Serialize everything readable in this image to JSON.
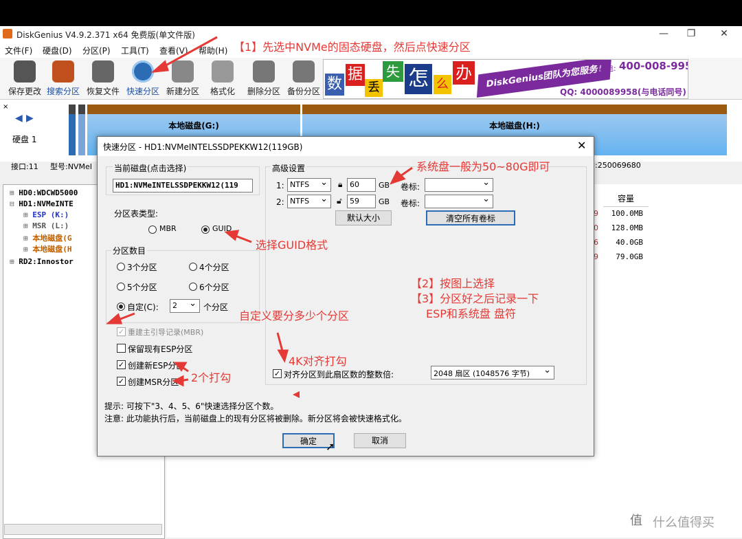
{
  "window": {
    "title": "DiskGenius V4.9.2.371 x64 免费版(单文件版)",
    "minimize": "—",
    "maximize": "❐",
    "close": "✕"
  },
  "menu": [
    "文件(F)",
    "硬盘(D)",
    "分区(P)",
    "工具(T)",
    "查看(V)",
    "帮助(H)"
  ],
  "toolbar": [
    {
      "label": "保存更改",
      "icon": "save-icon",
      "color": "#555555"
    },
    {
      "label": "搜索分区",
      "icon": "search-icon",
      "color": "#c0501e"
    },
    {
      "label": "恢复文件",
      "icon": "restore-icon",
      "color": "#666666"
    },
    {
      "label": "快速分区",
      "icon": "quick-partition-icon",
      "color": "#2b6cb5"
    },
    {
      "label": "新建分区",
      "icon": "new-partition-icon",
      "color": "#888888"
    },
    {
      "label": "格式化",
      "icon": "format-icon",
      "color": "#999999"
    },
    {
      "label": "删除分区",
      "icon": "delete-icon",
      "color": "#777777"
    },
    {
      "label": "备份分区",
      "icon": "backup-icon",
      "color": "#777777"
    }
  ],
  "banner": {
    "chars": [
      "数",
      "据",
      "丢",
      "失",
      "怎",
      "么",
      "办"
    ],
    "brand": "DiskGenius团队为您服务!",
    "phone": "400-008-9958",
    "qq": "QQ: 4000089958(与电话同号)",
    "phone_prefix": "致电:"
  },
  "annotations": {
    "step1": "【1】先选中NVMe的固态硬盘，然后点快速分区",
    "system_size": "系统盘一般为50~80G即可",
    "guid": "选择GUID格式",
    "custom": "自定义要分多少个分区",
    "step2": "【2】按图上选择",
    "step3": "【3】分区好之后记录一下",
    "step3b": "ESP和系统盘 盘符",
    "align": "4K对齐打勾",
    "two_checks": "2个打勾"
  },
  "diskmap": {
    "disk_label": "硬盘 1",
    "part_g": "本地磁盘(G:)",
    "part_h": "本地磁盘(H:)",
    "fs": "NTFS",
    "iface": "接口:11",
    "model": "型号:NVMeI",
    "sectors": ":250069680"
  },
  "tree": [
    {
      "label": "HD0:WDCWD5000",
      "color": "#000000"
    },
    {
      "label": "HD1:NVMeINTE",
      "color": "#000000"
    },
    {
      "label": "ESP (K:)",
      "color": "#2233cc"
    },
    {
      "label": "MSR (L:)",
      "color": "#555555"
    },
    {
      "label": "本地磁盘(G",
      "color": "#c06000"
    },
    {
      "label": "本地磁盘(H",
      "color": "#c06000"
    },
    {
      "label": "RD2:Innostor",
      "color": "#000000"
    }
  ],
  "table": {
    "header": "容量",
    "rows": [
      {
        "a": "9",
        "size": "100.0MB"
      },
      {
        "a": "0",
        "size": "128.0MB"
      },
      {
        "a": "6",
        "size": "40.0GB"
      },
      {
        "a": "9",
        "size": "79.0GB"
      }
    ]
  },
  "dialog": {
    "title": "快速分区 - HD1:NVMeINTELSSDPEKKW12(119GB)",
    "current_disk_label": "当前磁盘(点击选择)",
    "current_disk_value": "HD1:NVMeINTELSSDPEKKW12(119",
    "table_type_label": "分区表类型:",
    "mbr": "MBR",
    "guid": "GUID",
    "count_label": "分区数目",
    "opt3": "3个分区",
    "opt4": "4个分区",
    "opt5": "5个分区",
    "opt6": "6个分区",
    "custom_label": "自定(C):",
    "custom_value": "2",
    "custom_suffix": "个分区",
    "chk_rebuild_mbr": "重建主引导记录(MBR)",
    "chk_keep_esp": "保留现有ESP分区",
    "chk_new_esp": "创建新ESP分区",
    "chk_msr": "创建MSR分区",
    "advanced_label": "高级设置",
    "row1_idx": "1:",
    "row2_idx": "2:",
    "row1_fs": "NTFS",
    "row2_fs": "NTFS",
    "row1_size": "60",
    "row2_size": "59",
    "gb": "GB",
    "volume_label": "卷标:",
    "default_size_btn": "默认大小",
    "clear_labels_btn": "清空所有卷标",
    "align_label": "对齐分区到此扇区数的整数倍:",
    "align_value": "2048 扇区 (1048576 字节)",
    "hint1": "提示: 可按下\"3、4、5、6\"快速选择分区个数。",
    "hint2": "注意: 此功能执行后，当前磁盘上的现有分区将被删除。新分区将会被快速格式化。",
    "ok": "确定",
    "cancel": "取消"
  },
  "watermark": "值 什么值得买"
}
